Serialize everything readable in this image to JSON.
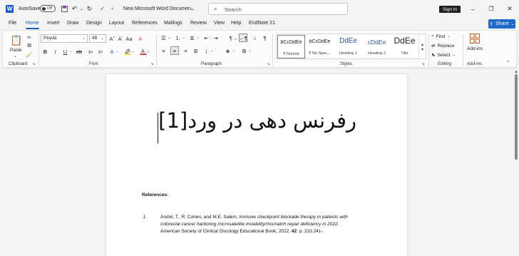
{
  "titlebar": {
    "app_icon": "word-logo",
    "app_letter": "W",
    "autosave_label": "AutoSave",
    "autosave_state": "Off",
    "quick_access_icons": [
      "save-icon",
      "undo-icon",
      "undo-dropdown-icon",
      "redo-icon",
      "spelling-icon",
      "customize-qat-icon"
    ],
    "doc_title": "New Microsoft Word Documen...",
    "search_placeholder": "Search",
    "signin_label": "Sign in",
    "window_controls": [
      "minimize-icon",
      "restore-icon",
      "close-icon"
    ]
  },
  "menu": {
    "tabs": [
      "File",
      "Home",
      "Insert",
      "Draw",
      "Design",
      "Layout",
      "References",
      "Mailings",
      "Review",
      "View",
      "Help",
      "EndNote 21"
    ],
    "active_tab": "Home",
    "share_label": "Share",
    "accent_color": "#185abd"
  },
  "ribbon": {
    "clipboard": {
      "label": "Clipboard",
      "paste_label": "Paste"
    },
    "font": {
      "label": "Font",
      "font_name": "Peyda",
      "font_size": "48"
    },
    "paragraph": {
      "label": "Paragraph"
    },
    "styles": {
      "label": "Styles",
      "items": [
        {
          "sample": "bCcDdEe",
          "name": "¶ Normal"
        },
        {
          "sample": "bCcDdEe",
          "name": "¶ No Spac..."
        },
        {
          "sample": "DdEe",
          "name": "Heading 1"
        },
        {
          "sample": "cDdEe",
          "name": "Heading 2"
        },
        {
          "sample": "DdEe",
          "name": "Title"
        }
      ]
    },
    "editing": {
      "label": "Editing",
      "find_label": "Find",
      "replace_label": "Replace",
      "select_label": "Select"
    },
    "addins": {
      "label": "Add-ins",
      "button_label": "Add-ins"
    }
  },
  "document": {
    "heading": "رفرنس دهی در ورد[1]",
    "references_heading": "References:",
    "ref_number": ".1",
    "ref_lines": [
      {
        "normal": "André, T., R. Cohen, and M.E. Salem, ",
        "italic": "Immune checkpoint blockade therapy in patients with"
      },
      {
        "normal": "",
        "italic": "colorectal cancer harboring microsatellite instability/mismatch repair deficiency in 2022."
      },
      {
        "normal": "American Society of Clinical Oncology Educational Book, 2022. ",
        "bold": "42",
        "tail": ": p. 233.241-"
      }
    ]
  }
}
